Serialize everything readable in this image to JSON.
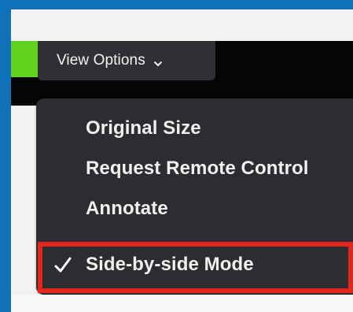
{
  "toolbar": {
    "view_options_label": "View Options",
    "view_options_icon": "chevron-down-icon"
  },
  "menu": {
    "items": [
      {
        "label": "Original Size",
        "checked": false
      },
      {
        "label": "Request Remote Control",
        "checked": false
      },
      {
        "label": "Annotate",
        "checked": false
      },
      {
        "label": "Side-by-side Mode",
        "checked": true
      }
    ],
    "check_icon": "check-icon"
  },
  "colors": {
    "outer_border": "#0f72b8",
    "background": "#f2f2f2",
    "toolbar_bg": "#2f3033",
    "menu_bg": "#2c2d30",
    "accent_green": "#5fd11f",
    "highlight_border": "#e3251d",
    "text": "#f1f1f1"
  }
}
